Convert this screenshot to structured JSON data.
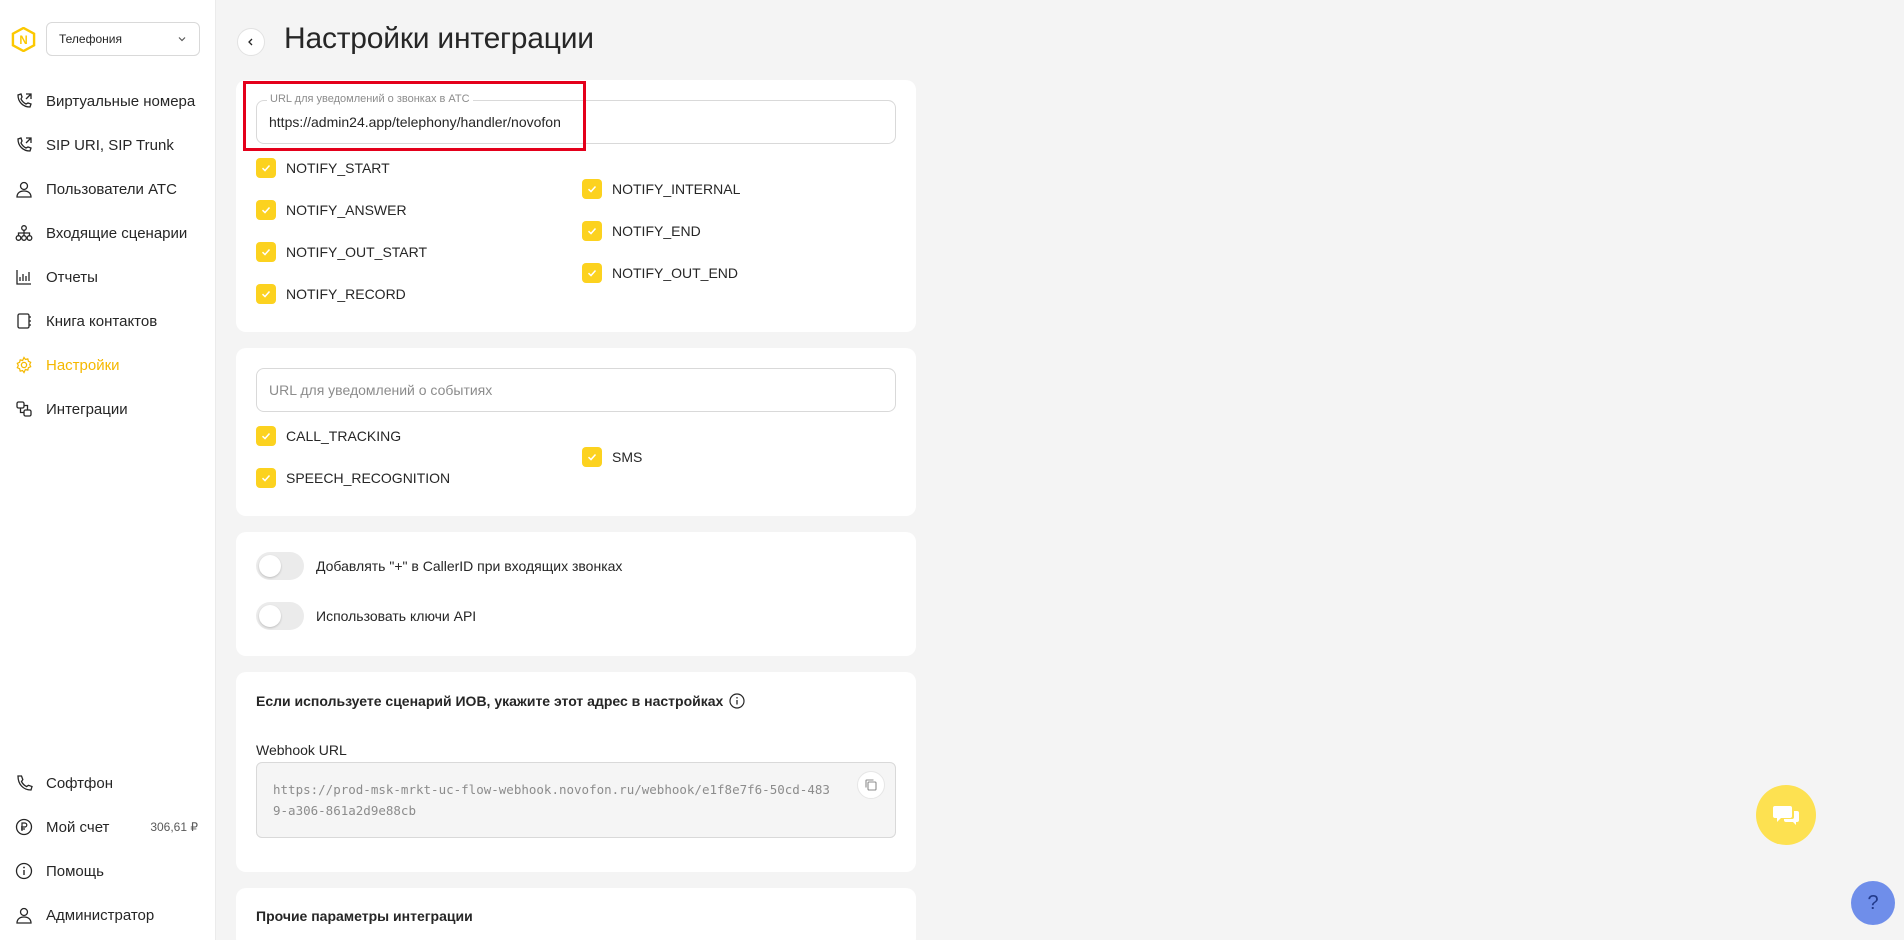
{
  "sidebar": {
    "product_select": "Телефония",
    "items": [
      {
        "label": "Виртуальные номера",
        "icon": "phone-forward-icon"
      },
      {
        "label": "SIP URI, SIP Trunk",
        "icon": "phone-forward-icon"
      },
      {
        "label": "Пользователи АТС",
        "icon": "user-icon"
      },
      {
        "label": "Входящие сценарии",
        "icon": "flow-icon"
      },
      {
        "label": "Отчеты",
        "icon": "chart-icon"
      },
      {
        "label": "Книга контактов",
        "icon": "contacts-book-icon"
      },
      {
        "label": "Настройки",
        "icon": "gear-icon",
        "active": true
      },
      {
        "label": "Интеграции",
        "icon": "integrations-icon"
      }
    ],
    "bottom": [
      {
        "label": "Софтфон",
        "icon": "phone-icon"
      },
      {
        "label": "Мой счет",
        "icon": "ruble-icon",
        "value": "306,61 ₽"
      },
      {
        "label": "Помощь",
        "icon": "info-icon"
      },
      {
        "label": "Администратор",
        "icon": "user-icon"
      }
    ]
  },
  "header": {
    "title": "Настройки интеграции"
  },
  "ats_card": {
    "url_label": "URL для уведомлений о звонках в АТС",
    "url_value": "https://admin24.app/telephony/handler/novofon",
    "left_checks": [
      "NOTIFY_START",
      "NOTIFY_ANSWER",
      "NOTIFY_OUT_START",
      "NOTIFY_RECORD"
    ],
    "right_checks": [
      "NOTIFY_INTERNAL",
      "NOTIFY_END",
      "NOTIFY_OUT_END"
    ]
  },
  "events_card": {
    "url_placeholder": "URL для уведомлений о событиях",
    "left_checks": [
      "CALL_TRACKING",
      "SPEECH_RECOGNITION"
    ],
    "right_checks": [
      "SMS"
    ]
  },
  "toggles_card": {
    "add_plus": "Добавлять \"+\" в CallerID при входящих звонках",
    "use_api_keys": "Использовать ключи API"
  },
  "ivr_card": {
    "title": "Если используете сценарий ИОВ, укажите этот адрес в настройках",
    "webhook_label": "Webhook URL",
    "webhook_value": "https://prod-msk-mrkt-uc-flow-webhook.novofon.ru/webhook/e1f8e7f6-50cd-4839-a306-861a2d9e88cb"
  },
  "other_card": {
    "title": "Прочие параметры интеграции"
  },
  "help_label": "?",
  "colors": {
    "accent": "#fcd21f",
    "active_nav": "#f5b800",
    "highlight": "#e4001b",
    "help": "#6f8eea"
  }
}
